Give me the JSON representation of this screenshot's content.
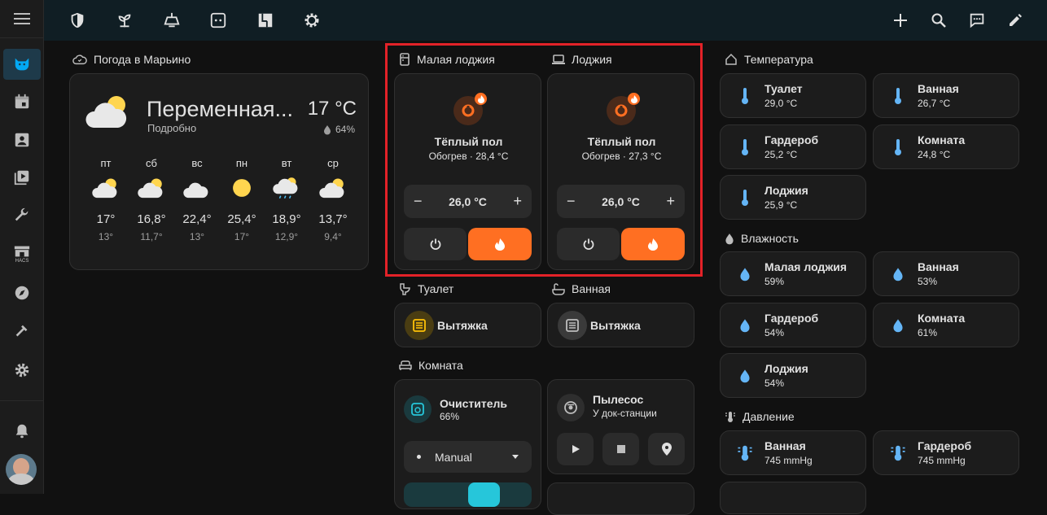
{
  "topbar": {
    "icons": [
      "shield-icon",
      "sprout-icon",
      "chandelier-icon",
      "socket-icon",
      "floor-plan-icon",
      "gear-icon"
    ],
    "actions": [
      "plus-icon",
      "search-icon",
      "assist-icon",
      "pencil-icon"
    ]
  },
  "sidebar": {
    "items": [
      "menu-icon",
      "cat-icon",
      "calendar-icon",
      "account-box-icon",
      "media-icon",
      "wrench-icon",
      "hacs-icon",
      "compass-icon",
      "hammer-icon",
      "gear-icon",
      "bell-icon",
      "avatar"
    ],
    "hacs_label": "HACS"
  },
  "weather": {
    "title": "Погода в Марьино",
    "condition": "Переменная...",
    "subtitle": "Подробно",
    "temperature": "17 °C",
    "humidity": "64%",
    "forecast": [
      {
        "day": "пт",
        "high": "17°",
        "low": "13°",
        "icon": "partly-cloudy"
      },
      {
        "day": "сб",
        "high": "16,8°",
        "low": "11,7°",
        "icon": "partly-cloudy"
      },
      {
        "day": "вс",
        "high": "22,4°",
        "low": "13°",
        "icon": "cloudy"
      },
      {
        "day": "пн",
        "high": "25,4°",
        "low": "17°",
        "icon": "sunny"
      },
      {
        "day": "вт",
        "high": "18,9°",
        "low": "12,9°",
        "icon": "rainy"
      },
      {
        "day": "ср",
        "high": "13,7°",
        "low": "9,4°",
        "icon": "partly-cloudy"
      }
    ]
  },
  "small_loggia": {
    "title": "Малая лоджия",
    "name": "Тёплый пол",
    "state": "Обогрев · 28,4 °C",
    "target": "26,0 °C",
    "minus": "−",
    "plus": "+"
  },
  "loggia": {
    "title": "Лоджия",
    "name": "Тёплый пол",
    "state": "Обогрев · 27,3 °C",
    "target": "26,0 °C",
    "minus": "−",
    "plus": "+"
  },
  "toilet": {
    "title": "Туалет",
    "fan": "Вытяжка"
  },
  "bathroom": {
    "title": "Ванная",
    "fan": "Вытяжка"
  },
  "room": {
    "title": "Комната",
    "purifier": {
      "name": "Очиститель",
      "state": "66%",
      "mode": "Manual"
    },
    "vacuum": {
      "name": "Пылесос",
      "state": "У док-станции"
    }
  },
  "temperature": {
    "title": "Температура",
    "items": [
      {
        "name": "Туалет",
        "value": "29,0 °C"
      },
      {
        "name": "Ванная",
        "value": "26,7 °C"
      },
      {
        "name": "Гардероб",
        "value": "25,2 °C"
      },
      {
        "name": "Комната",
        "value": "24,8 °C"
      },
      {
        "name": "Лоджия",
        "value": "25,9 °C"
      }
    ]
  },
  "humidity": {
    "title": "Влажность",
    "items": [
      {
        "name": "Малая лоджия",
        "value": "59%"
      },
      {
        "name": "Ванная",
        "value": "53%"
      },
      {
        "name": "Гардероб",
        "value": "54%"
      },
      {
        "name": "Комната",
        "value": "61%"
      },
      {
        "name": "Лоджия",
        "value": "54%"
      }
    ]
  },
  "pressure": {
    "title": "Давление",
    "items": [
      {
        "name": "Ванная",
        "value": "745 mmHg"
      },
      {
        "name": "Гардероб",
        "value": "745 mmHg"
      }
    ]
  },
  "colors": {
    "accent": "#03a9f4",
    "heat": "#ff6f22",
    "fan": "#ffc107",
    "highlight": "#e32228"
  }
}
